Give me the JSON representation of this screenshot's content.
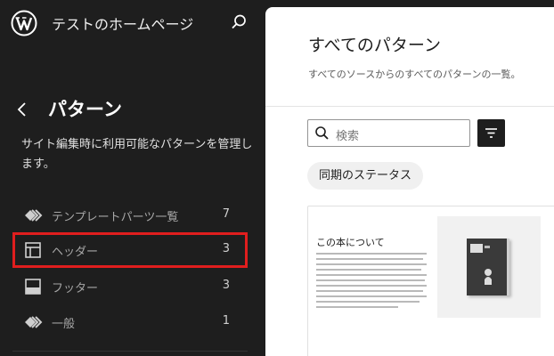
{
  "header": {
    "site_title": "テストのホームページ"
  },
  "sidebar": {
    "title": "パターン",
    "description": "サイト編集時に利用可能なパターンを管理します。",
    "items": [
      {
        "label": "テンプレートパーツ一覧",
        "count": "7",
        "icon": "symbol-icon"
      },
      {
        "label": "ヘッダー",
        "count": "3",
        "icon": "header-icon"
      },
      {
        "label": "フッター",
        "count": "3",
        "icon": "footer-icon"
      },
      {
        "label": "一般",
        "count": "1",
        "icon": "symbol-icon"
      }
    ]
  },
  "main": {
    "title": "すべてのパターン",
    "description": "すべてのソースからのすべてのパターンの一覧。",
    "search": {
      "placeholder": "検索"
    },
    "sync_status": "同期のステータス",
    "card": {
      "heading": "この本について"
    }
  },
  "colors": {
    "sidebar_bg": "#1e1e1e",
    "highlight": "#e01e1e",
    "main_bg": "#ffffff"
  }
}
